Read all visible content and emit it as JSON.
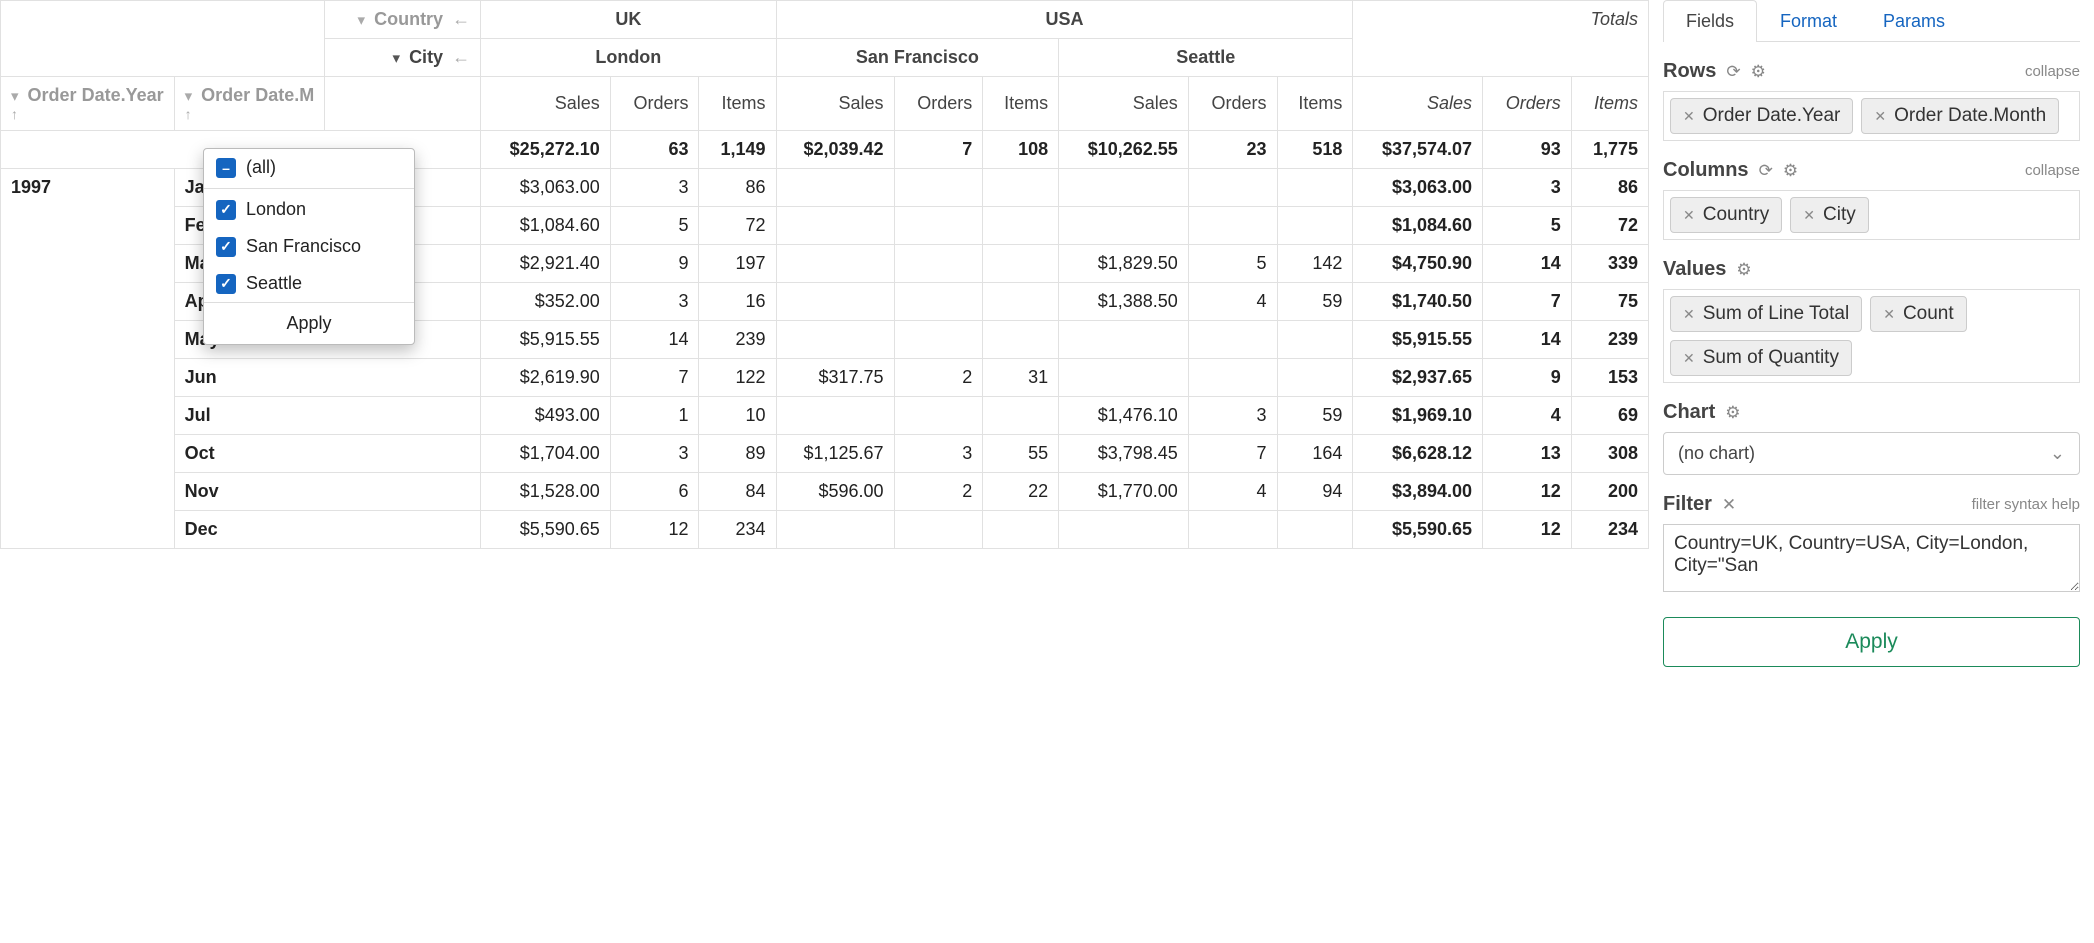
{
  "pivot": {
    "country_label": "Country",
    "city_label": "City",
    "row_dim1": "Order Date.Year",
    "row_dim2": "Order Date.M",
    "countries": [
      "UK",
      "USA"
    ],
    "cities": [
      "London",
      "San Francisco",
      "Seattle"
    ],
    "totals_label": "Totals",
    "measures": [
      "Sales",
      "Orders",
      "Items"
    ],
    "summary": {
      "london": [
        "$25,272.10",
        "63",
        "1,149"
      ],
      "sf": [
        "$2,039.42",
        "7",
        "108"
      ],
      "seattle": [
        "$10,262.55",
        "23",
        "518"
      ],
      "totals": [
        "$37,574.07",
        "93",
        "1,775"
      ]
    },
    "year": "1997",
    "rows": [
      {
        "m": "Jan",
        "d": [
          "$3,063.00",
          "3",
          "86",
          "",
          "",
          "",
          "",
          "",
          "",
          "$3,063.00",
          "3",
          "86"
        ]
      },
      {
        "m": "Feb",
        "d": [
          "$1,084.60",
          "5",
          "72",
          "",
          "",
          "",
          "",
          "",
          "",
          "$1,084.60",
          "5",
          "72"
        ]
      },
      {
        "m": "Mar",
        "d": [
          "$2,921.40",
          "9",
          "197",
          "",
          "",
          "",
          "$1,829.50",
          "5",
          "142",
          "$4,750.90",
          "14",
          "339"
        ]
      },
      {
        "m": "Apr",
        "d": [
          "$352.00",
          "3",
          "16",
          "",
          "",
          "",
          "$1,388.50",
          "4",
          "59",
          "$1,740.50",
          "7",
          "75"
        ]
      },
      {
        "m": "May",
        "d": [
          "$5,915.55",
          "14",
          "239",
          "",
          "",
          "",
          "",
          "",
          "",
          "$5,915.55",
          "14",
          "239"
        ]
      },
      {
        "m": "Jun",
        "d": [
          "$2,619.90",
          "7",
          "122",
          "$317.75",
          "2",
          "31",
          "",
          "",
          "",
          "$2,937.65",
          "9",
          "153"
        ]
      },
      {
        "m": "Jul",
        "d": [
          "$493.00",
          "1",
          "10",
          "",
          "",
          "",
          "$1,476.10",
          "3",
          "59",
          "$1,969.10",
          "4",
          "69"
        ]
      },
      {
        "m": "Oct",
        "d": [
          "$1,704.00",
          "3",
          "89",
          "$1,125.67",
          "3",
          "55",
          "$3,798.45",
          "7",
          "164",
          "$6,628.12",
          "13",
          "308"
        ]
      },
      {
        "m": "Nov",
        "d": [
          "$1,528.00",
          "6",
          "84",
          "$596.00",
          "2",
          "22",
          "$1,770.00",
          "4",
          "94",
          "$3,894.00",
          "12",
          "200"
        ]
      },
      {
        "m": "Dec",
        "d": [
          "$5,590.65",
          "12",
          "234",
          "",
          "",
          "",
          "",
          "",
          "",
          "$5,590.65",
          "12",
          "234"
        ]
      }
    ]
  },
  "city_filter": {
    "all_label": "(all)",
    "options": [
      "London",
      "San Francisco",
      "Seattle"
    ],
    "apply_label": "Apply"
  },
  "side": {
    "tabs": {
      "fields": "Fields",
      "format": "Format",
      "params": "Params"
    },
    "rows_title": "Rows",
    "columns_title": "Columns",
    "values_title": "Values",
    "chart_title": "Chart",
    "filter_title": "Filter",
    "collapse_label": "collapse",
    "filter_help": "filter syntax help",
    "row_chips": [
      "Order Date.Year",
      "Order Date.Month"
    ],
    "col_chips": [
      "Country",
      "City"
    ],
    "val_chips": [
      "Sum of Line Total",
      "Count",
      "Sum of Quantity"
    ],
    "chart_value": "(no chart)",
    "filter_text": "Country=UK, Country=USA, City=London, City=\"San",
    "apply_label": "Apply"
  }
}
